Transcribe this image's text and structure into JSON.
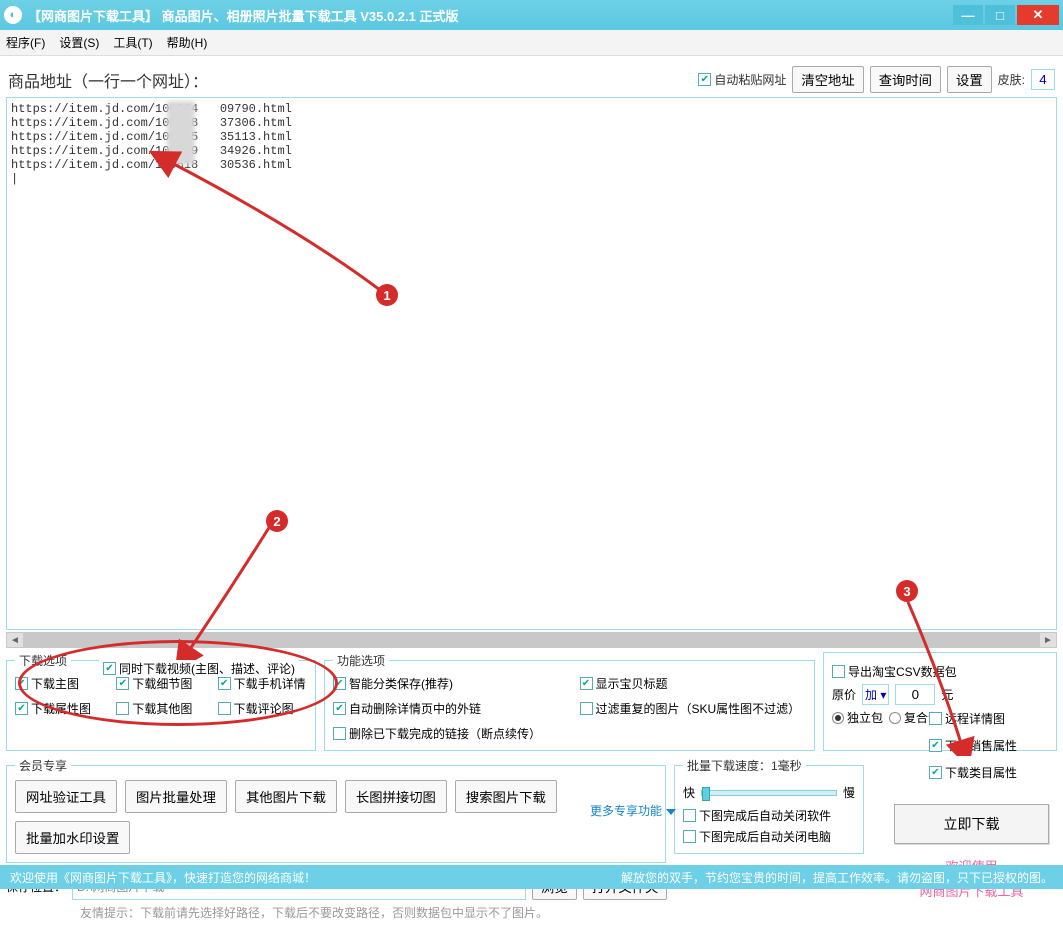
{
  "window": {
    "title": "【网商图片下载工具】 商品图片、相册照片批量下载工具 V35.0.2.1 正式版"
  },
  "menu": {
    "program": "程序(F)",
    "settings": "设置(S)",
    "tools": "工具(T)",
    "help": "帮助(H)"
  },
  "section": {
    "title": "商品地址（一行一个网址）：",
    "autoPaste": "自动粘贴网址",
    "clearUrl": "清空地址",
    "queryTime": "查询时间",
    "settings": "设置",
    "skin": "皮肤:",
    "skinValue": "4"
  },
  "urls": "https://item.jd.com/100384   09790.html\nhttps://item.jd.com/100658   37306.html\nhttps://item.jd.com/100205   35113.html\nhttps://item.jd.com/100649   34926.html\nhttps://item.jd.com/100618   30536.html\n|",
  "downloadOpts": {
    "legend": "下载选项",
    "video": "同时下载视频(主图、描述、评论)",
    "main": "下载主图",
    "detail": "下载细节图",
    "mobile": "下载手机详情",
    "attr": "下载属性图",
    "other": "下载其他图",
    "comment": "下载评论图"
  },
  "funcOpts": {
    "legend": "功能选项",
    "smart": "智能分类保存(推荐)",
    "showTitle": "显示宝贝标题",
    "autoDelLink": "自动删除详情页中的外链",
    "filterDup": "过滤重复的图片（SKU属性图不过滤）",
    "delDone": "删除已下载完成的链接（断点续传）"
  },
  "exportBox": {
    "csv": "导出淘宝CSV数据包",
    "remoteDetail": "远程详情图",
    "price": "原价",
    "op": "加",
    "priceVal": "0",
    "unit": "元",
    "saleAttr": "下载销售属性",
    "single": "独立包",
    "combo": "复合包",
    "catAttr": "下载类目属性"
  },
  "member": {
    "legend": "会员专享",
    "b1": "网址验证工具",
    "b2": "图片批量处理",
    "b3": "其他图片下载",
    "b4": "长图拼接切图",
    "b5": "搜索图片下载",
    "b6": "批量加水印设置"
  },
  "more": "更多专享功能",
  "speed": {
    "legend": "批量下载速度：1毫秒",
    "fast": "快",
    "slow": "慢",
    "closeSoft": "下图完成后自动关闭软件",
    "closePC": "下图完成后自动关闭电脑"
  },
  "downloadNow": "立即下载",
  "pink": {
    "welcome": "欢迎使用",
    "tool": "网商图片下载工具"
  },
  "save": {
    "label": "保存位置：",
    "path": "D:\\网商图片下载",
    "browse": "浏览",
    "open": "打开文件夹",
    "hint": "友情提示：下载前请先选择好路径，下载后不要改变路径，否则数据包中显示不了图片。"
  },
  "status": {
    "left": "欢迎使用《网商图片下载工具》，快速打造您的网络商城！",
    "right": "解放您的双手，节约您宝贵的时间，提高工作效率。请勿盗图，只下已授权的图。"
  },
  "annot": {
    "n1": "1",
    "n2": "2",
    "n3": "3"
  }
}
